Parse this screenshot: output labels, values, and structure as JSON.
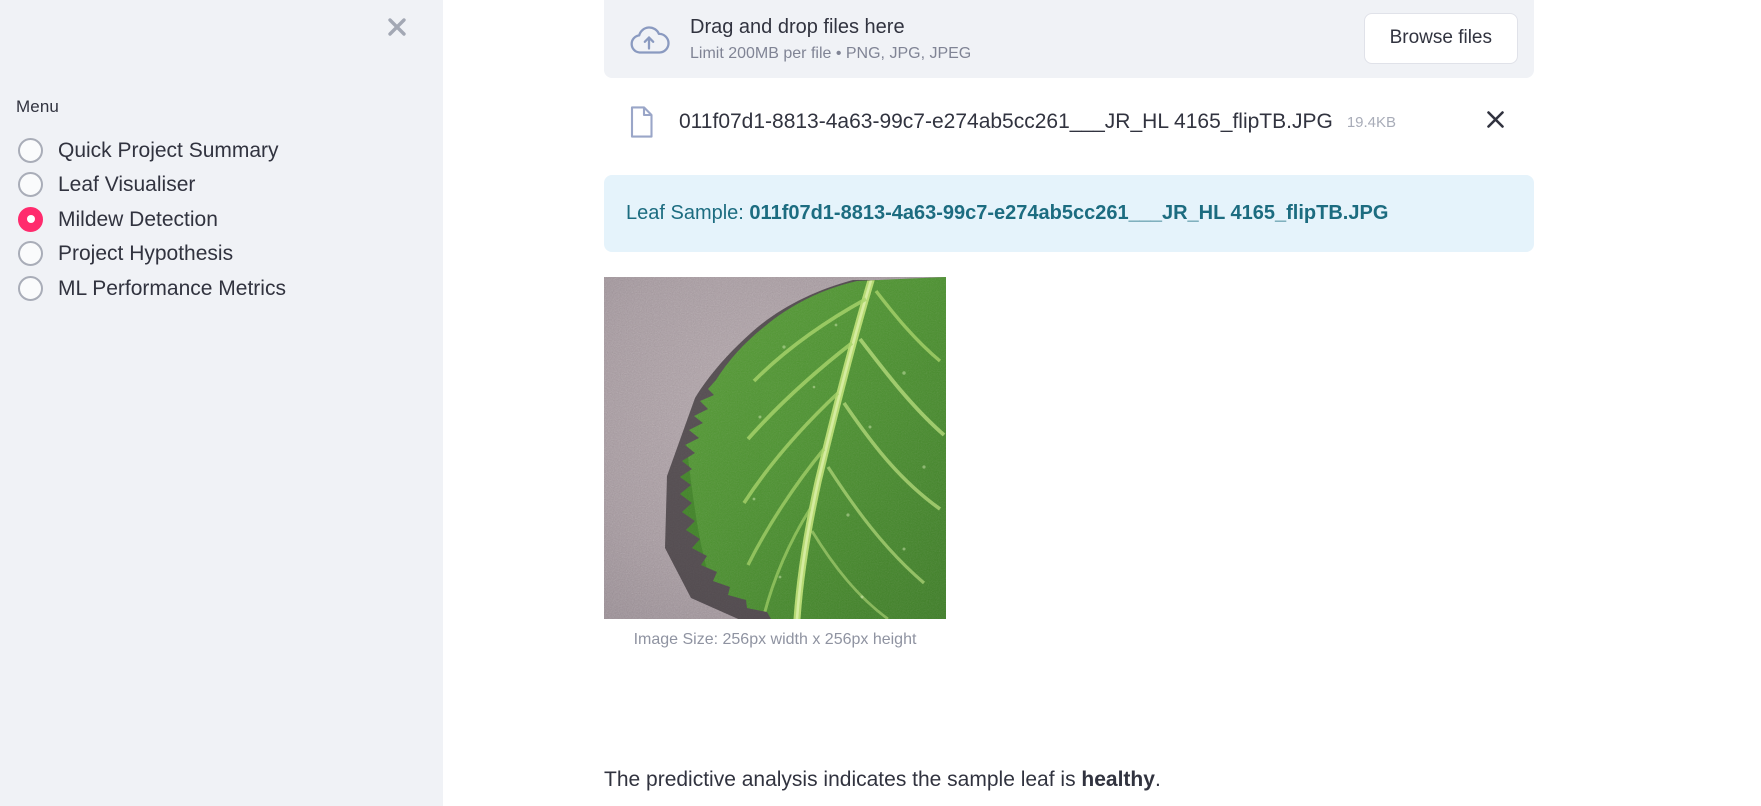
{
  "sidebar": {
    "close_icon": "close-icon",
    "menu_label": "Menu",
    "items": [
      {
        "label": "Quick Project Summary",
        "selected": false
      },
      {
        "label": "Leaf Visualiser",
        "selected": false
      },
      {
        "label": "Mildew Detection",
        "selected": true
      },
      {
        "label": "Project Hypothesis",
        "selected": false
      },
      {
        "label": "ML Performance Metrics",
        "selected": false
      }
    ],
    "accent_color": "#ff2b6d",
    "background_color": "#f0f2f6"
  },
  "uploader": {
    "icon": "cloud-upload-icon",
    "title": "Drag and drop files here",
    "subtitle": "Limit 200MB per file • PNG, JPG, JPEG",
    "browse_label": "Browse files"
  },
  "uploaded_file": {
    "icon": "document-icon",
    "name": "011f07d1-8813-4a63-99c7-e274ab5cc261___JR_HL 4165_flipTB.JPG",
    "size": "19.4KB",
    "remove_icon": "close-icon"
  },
  "result": {
    "banner_prefix": "Leaf Sample: ",
    "banner_filename": "011f07d1-8813-4a63-99c7-e274ab5cc261___JR_HL 4165_flipTB.JPG",
    "banner_bg_color": "#e5f3fb",
    "banner_text_color": "#1c6c80",
    "image_caption": "Image Size: 256px width x 256px height",
    "prediction_prefix": "The predictive analysis indicates the sample leaf is ",
    "prediction_verdict": "healthy",
    "prediction_suffix": "."
  }
}
